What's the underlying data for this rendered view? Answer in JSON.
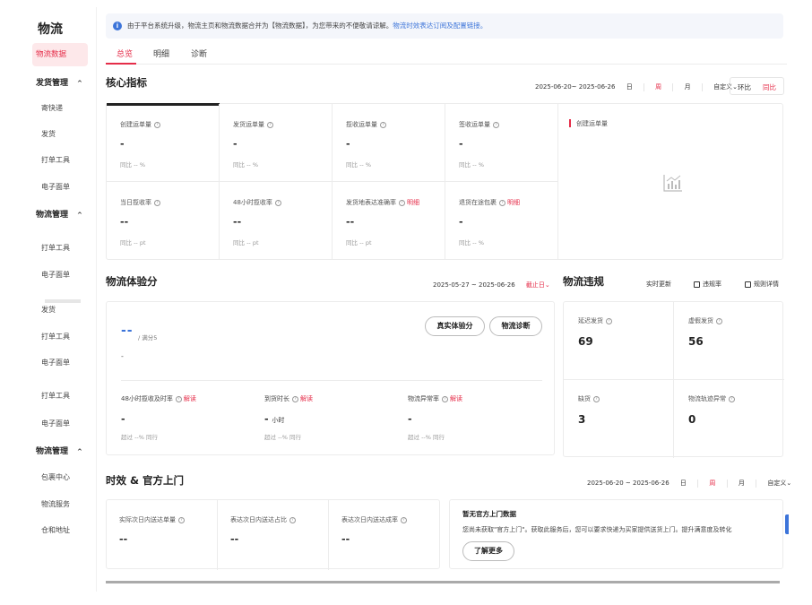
{
  "sidebar": {
    "title": "物流",
    "active_item": "物流数据",
    "groups": [
      {
        "label": "发货管理",
        "caret": "^"
      },
      {
        "label": "物流管理",
        "caret": "^"
      },
      {
        "label": "物流管理",
        "caret": "^"
      }
    ],
    "items": [
      "寄快递",
      "发货",
      "打单工具",
      "电子面单",
      "打单工具",
      "电子面单",
      "发货",
      "打单工具",
      "电子面单",
      "打单工具",
      "电子面单",
      "包裹中心",
      "物流服务",
      "仓和地址"
    ]
  },
  "notice": {
    "icon": "info-icon",
    "text": "由于平台系统升级，物流主页和物流数据合并为【物流数据】，为您带来的不便敬请谅解。",
    "link": "物流时效表达订阅及配置链接。"
  },
  "tabs": [
    "总览",
    "明细",
    "诊断"
  ],
  "core": {
    "title": "核心指标",
    "date_range": "2025-06-20~ 2025-06-26",
    "periods": [
      "日",
      "周",
      "月",
      "自定义⌄"
    ],
    "compare": [
      "环比",
      "同比"
    ],
    "metrics": [
      {
        "label": "创建运单量",
        "value": "-",
        "compare": "同比 -- %"
      },
      {
        "label": "发货运单量",
        "value": "-",
        "compare": "同比 -- %"
      },
      {
        "label": "揽收运单量",
        "value": "-",
        "compare": "同比 -- %"
      },
      {
        "label": "签收运单量",
        "value": "-",
        "compare": "同比 -- %"
      },
      {
        "label": "当日揽收率",
        "value": "--",
        "compare": "同比 -- pt"
      },
      {
        "label": "48小时揽收率",
        "value": "--",
        "compare": "同比 -- pt"
      },
      {
        "label": "发货地表达准确率",
        "value": "--",
        "compare": "同比 -- pt",
        "extra": "明细"
      },
      {
        "label": "退货在途包裹",
        "value": "-",
        "compare": "同比 -- %",
        "extra": "明细"
      }
    ],
    "chart_label": "创建运单量"
  },
  "experience": {
    "title": "物流体验分",
    "date_range": "2025-05-27 ~ 2025-06-26",
    "end_label": "截止日⌄",
    "score": "--",
    "full_score": "/ 满分5",
    "sub": "-",
    "buttons": [
      "真实体验分",
      "物流诊断"
    ],
    "metrics": [
      {
        "label": "48小时揽收及时率",
        "link": "解读",
        "value": "-",
        "unit": "",
        "compare": "超过 --% 同行"
      },
      {
        "label": "到货时长",
        "link": "解读",
        "value": "-",
        "unit": "小时",
        "compare": "超过 --% 同行"
      },
      {
        "label": "物流异常率",
        "link": "解读",
        "value": "-",
        "unit": "",
        "compare": "超过 --% 同行"
      }
    ]
  },
  "violation": {
    "title": "物流违规",
    "realtime": "实时更新",
    "rate_label": "违规率",
    "rules_label": "规则详情",
    "metrics": [
      {
        "label": "延迟发货",
        "value": "69"
      },
      {
        "label": "虚假发货",
        "value": "56"
      },
      {
        "label": "缺货",
        "value": "3"
      },
      {
        "label": "物流轨迹异常",
        "value": "0"
      }
    ]
  },
  "timing": {
    "title": "时效 & 官方上门",
    "date_range": "2025-06-20 ~ 2025-06-26",
    "periods": [
      "日",
      "周",
      "月",
      "自定义⌄"
    ],
    "metrics": [
      {
        "label": "实际次日内送达单量",
        "value": "--"
      },
      {
        "label": "表达次日内送达占比",
        "value": "--"
      },
      {
        "label": "表达次日内送达成率",
        "value": "--"
      }
    ],
    "official": {
      "title": "暂无官方上门数据",
      "desc": "您尚未获取\"官方上门\"。获取此服务后，您可以要求快递为买家提供送货上门。提升满意度及转化",
      "button": "了解更多"
    }
  },
  "colors": {
    "accent": "#e52d49",
    "link": "#3c74d9"
  }
}
